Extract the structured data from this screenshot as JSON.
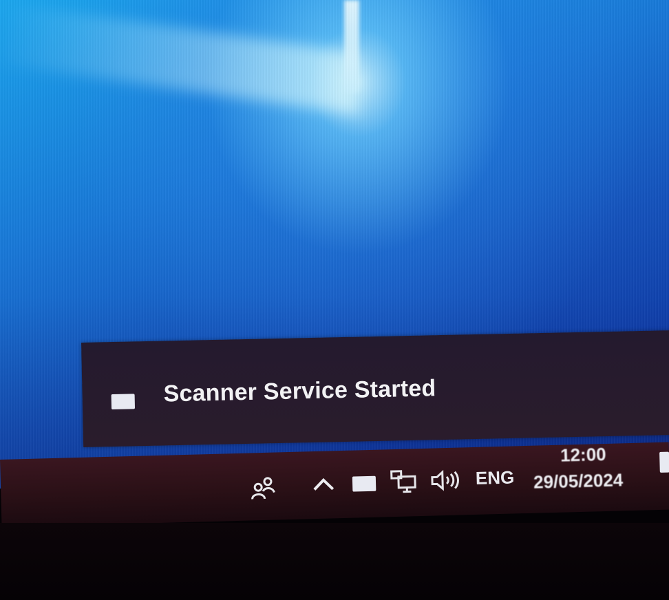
{
  "notification": {
    "title": "Scanner Service Started",
    "icon": "scanner-app-icon"
  },
  "taskbar": {
    "tray_icons": [
      "people-icon",
      "chevron-up-icon",
      "scanner-app-icon",
      "network-icon",
      "volume-icon"
    ],
    "language": "ENG",
    "time": "12:00",
    "date": "29/05/2024"
  },
  "colors": {
    "desktop_blue": "#1978d8",
    "toast_bg": "#241a2e",
    "taskbar_bg": "#2a1016",
    "text": "#f2f2f4"
  }
}
